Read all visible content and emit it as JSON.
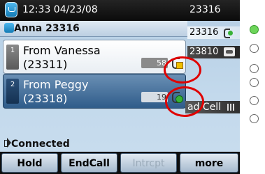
{
  "topbar": {
    "datetime": "12:33 04/23/08",
    "extension": "23316"
  },
  "line_header": {
    "name": "Anna 23316"
  },
  "calls": [
    {
      "index": "1",
      "line1": "From Vanessa",
      "line2": "(23311)",
      "timer": "58",
      "status_icon": "hold-icon"
    },
    {
      "index": "2",
      "line1": "From Peggy",
      "line2": "(23318)",
      "timer": "19",
      "status_icon": "connected-call-icon"
    }
  ],
  "right_lines": [
    {
      "label": "23316",
      "icon": "connected-line-icon"
    },
    {
      "label": "23810",
      "icon": "phone-line-icon"
    }
  ],
  "speed_dial": {
    "label": "ad Cell"
  },
  "status": {
    "text": "Connected"
  },
  "softkeys": [
    "Hold",
    "EndCall",
    "Intrcpt",
    "more"
  ],
  "colors": {
    "highlight": "#e00000",
    "active_line": "#6dd55a"
  }
}
